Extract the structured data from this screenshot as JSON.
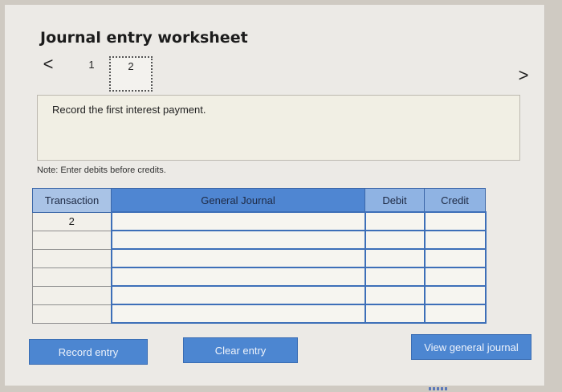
{
  "worksheet": {
    "title": "Journal entry worksheet",
    "nav": {
      "prev_glyph": "<",
      "next_glyph": ">",
      "steps": [
        "1",
        "2"
      ],
      "active_step": "2"
    },
    "instruction": "Record the first interest payment.",
    "note": "Note: Enter debits before credits."
  },
  "journal_table": {
    "headers": {
      "transaction": "Transaction",
      "general_journal": "General Journal",
      "debit": "Debit",
      "credit": "Credit"
    },
    "rows": [
      {
        "transaction": "2",
        "account": "",
        "debit": "",
        "credit": ""
      },
      {
        "transaction": "",
        "account": "",
        "debit": "",
        "credit": ""
      },
      {
        "transaction": "",
        "account": "",
        "debit": "",
        "credit": ""
      },
      {
        "transaction": "",
        "account": "",
        "debit": "",
        "credit": ""
      },
      {
        "transaction": "",
        "account": "",
        "debit": "",
        "credit": ""
      },
      {
        "transaction": "",
        "account": "",
        "debit": "",
        "credit": ""
      }
    ]
  },
  "buttons": {
    "record": "Record entry",
    "clear": "Clear entry",
    "view": "View general journal"
  },
  "colors": {
    "accent": "#4c86d1",
    "header": "#5b8fd4",
    "panel": "#eceae6"
  }
}
